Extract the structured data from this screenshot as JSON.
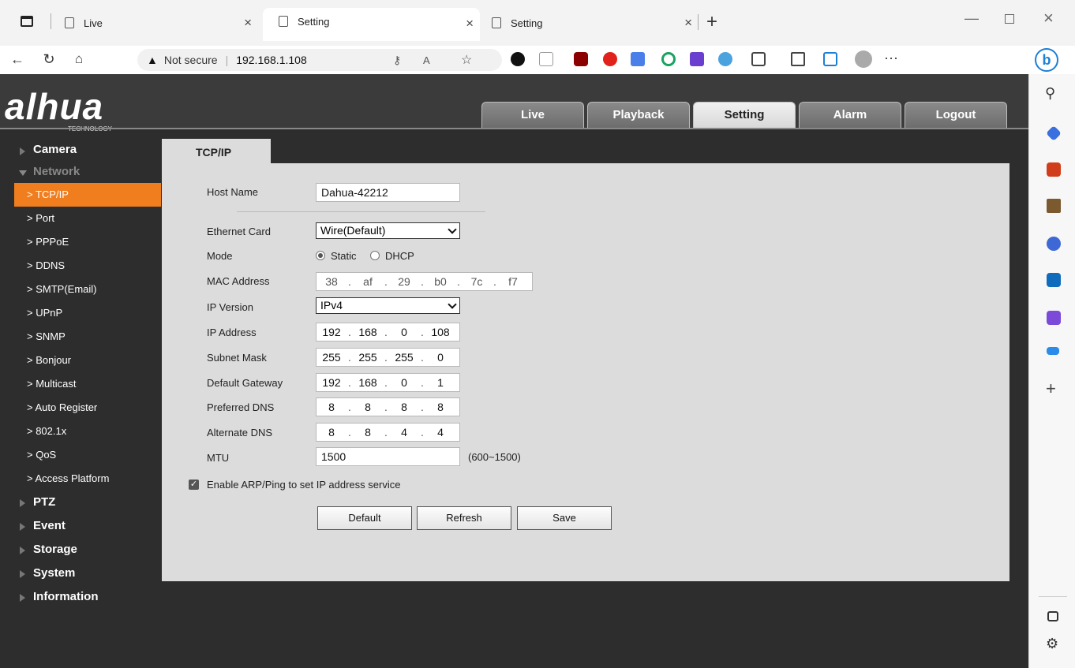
{
  "browser": {
    "tabs": [
      {
        "title": "Live"
      },
      {
        "title": "Setting"
      },
      {
        "title": "Setting"
      }
    ],
    "security_label": "Not secure",
    "url": "192.168.1.108"
  },
  "app": {
    "logo_text": "alhua",
    "logo_sub": "TECHNOLOGY",
    "menu": [
      "Live",
      "Playback",
      "Setting",
      "Alarm",
      "Logout"
    ],
    "active_menu": "Setting"
  },
  "leftnav": {
    "categories": {
      "camera": "Camera",
      "network": "Network",
      "ptz": "PTZ",
      "event": "Event",
      "storage": "Storage",
      "system": "System",
      "information": "Information"
    },
    "network_items": [
      "> TCP/IP",
      "> Port",
      "> PPPoE",
      "> DDNS",
      "> SMTP(Email)",
      "> UPnP",
      "> SNMP",
      "> Bonjour",
      "> Multicast",
      "> Auto Register",
      "> 802.1x",
      "> QoS",
      "> Access Platform"
    ],
    "active_item": "TCP/IP"
  },
  "content": {
    "tab_title": "TCP/IP",
    "labels": {
      "host_name": "Host Name",
      "ethernet_card": "Ethernet Card",
      "mode": "Mode",
      "mac": "MAC Address",
      "ip_version": "IP Version",
      "ip_address": "IP Address",
      "subnet": "Subnet Mask",
      "gateway": "Default Gateway",
      "pdns": "Preferred DNS",
      "adns": "Alternate DNS",
      "mtu": "MTU"
    },
    "host_name": "Dahua-42212",
    "ethernet_card": "Wire(Default)",
    "mode_static": "Static",
    "mode_dhcp": "DHCP",
    "mac": [
      "38",
      "af",
      "29",
      "b0",
      "7c",
      "f7"
    ],
    "ip_version": "IPv4",
    "ip_address": [
      "192",
      "168",
      "0",
      "108"
    ],
    "subnet": [
      "255",
      "255",
      "255",
      "0"
    ],
    "gateway": [
      "192",
      "168",
      "0",
      "1"
    ],
    "pdns": [
      "8",
      "8",
      "8",
      "8"
    ],
    "adns": [
      "8",
      "8",
      "4",
      "4"
    ],
    "mtu": "1500",
    "mtu_range": "(600~1500)",
    "arp_label": "Enable ARP/Ping to set IP address service",
    "buttons": {
      "default": "Default",
      "refresh": "Refresh",
      "save": "Save"
    }
  }
}
